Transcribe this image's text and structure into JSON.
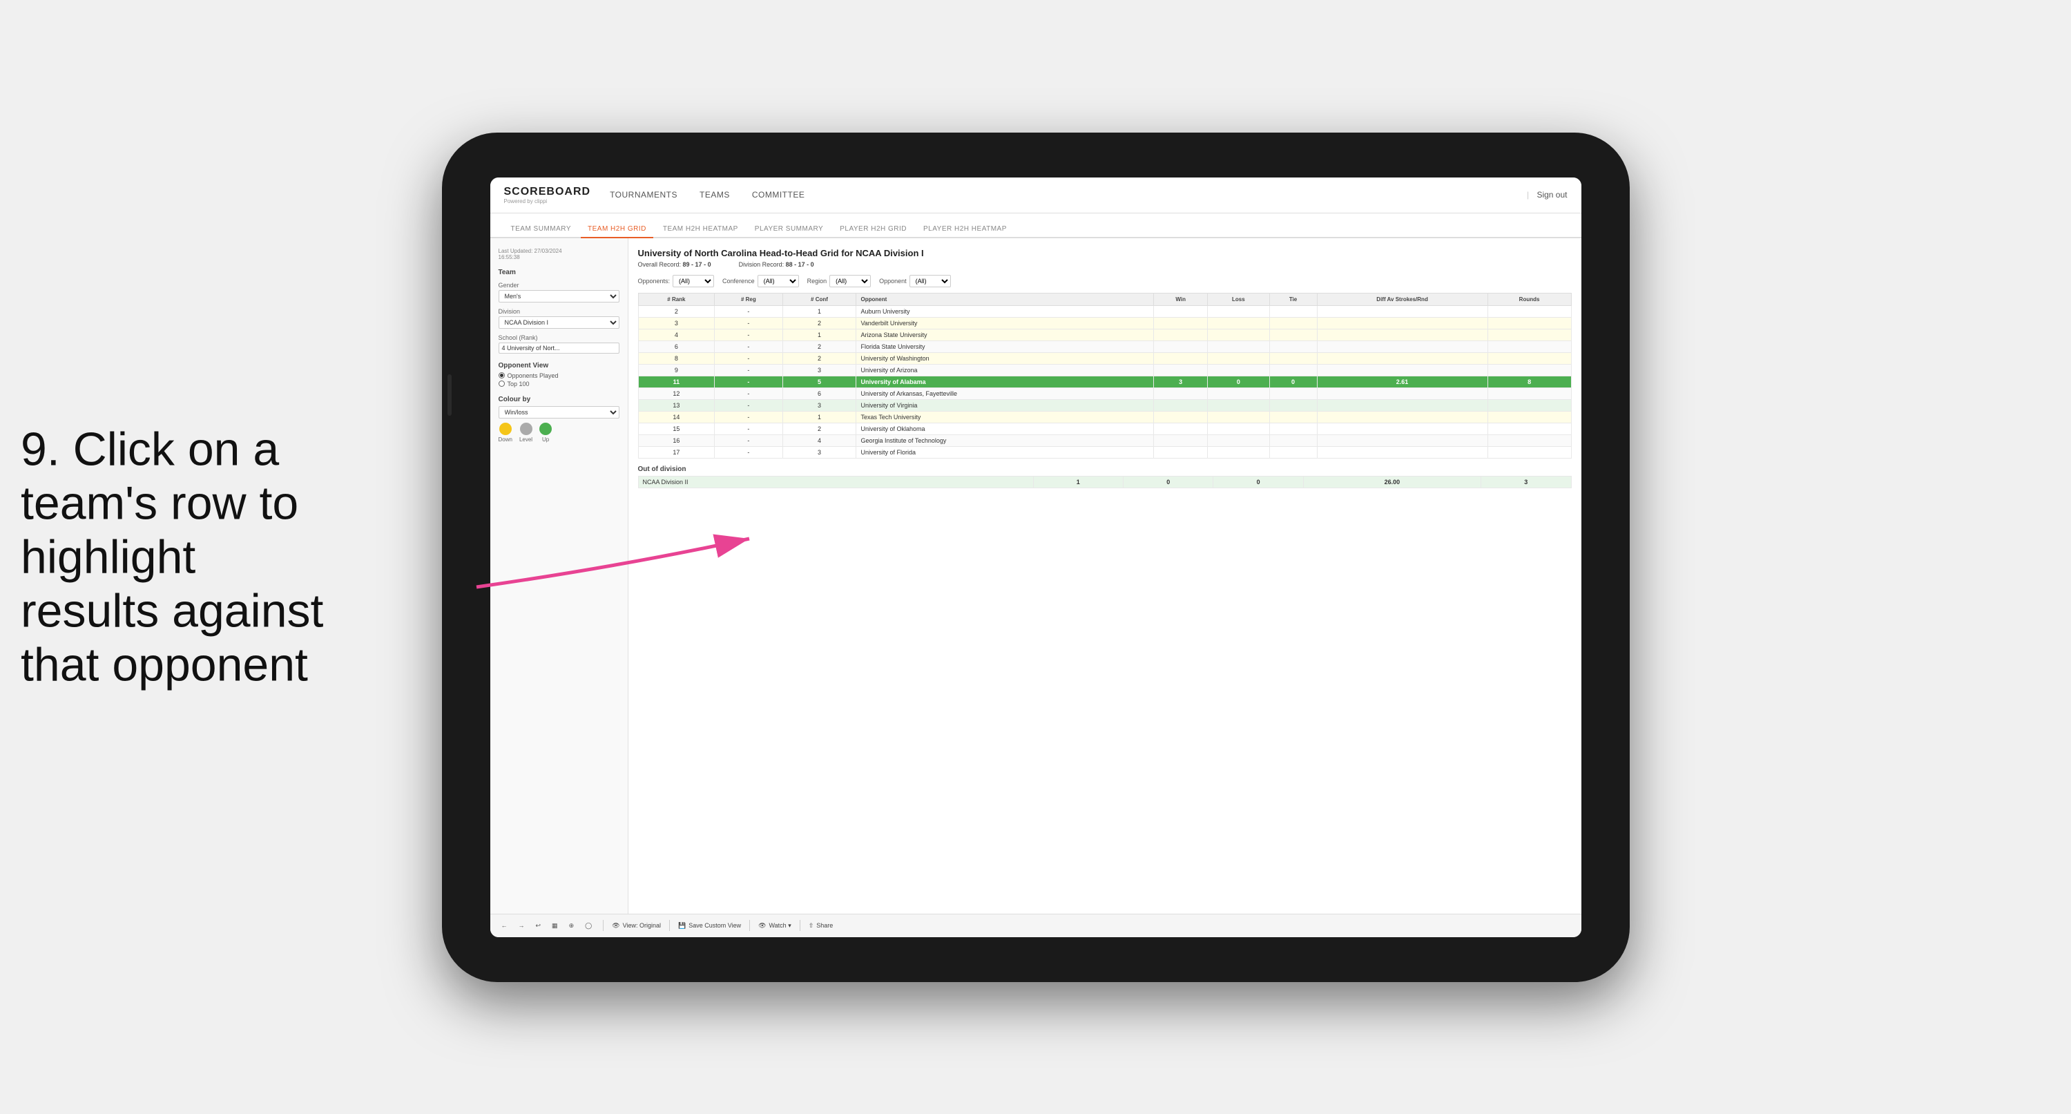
{
  "annotation": {
    "text": "9. Click on a team's row to highlight results against that opponent"
  },
  "nav": {
    "logo": "SCOREBOARD",
    "logo_sub": "Powered by clippi",
    "links": [
      "TOURNAMENTS",
      "TEAMS",
      "COMMITTEE"
    ],
    "sign_out": "Sign out"
  },
  "sub_nav": {
    "items": [
      "TEAM SUMMARY",
      "TEAM H2H GRID",
      "TEAM H2H HEATMAP",
      "PLAYER SUMMARY",
      "PLAYER H2H GRID",
      "PLAYER H2H HEATMAP"
    ],
    "active": "TEAM H2H GRID"
  },
  "sidebar": {
    "last_updated": "Last Updated: 27/03/2024",
    "last_updated_time": "16:55:38",
    "team_label": "Team",
    "gender_label": "Gender",
    "gender_value": "Men's",
    "division_label": "Division",
    "division_value": "NCAA Division I",
    "school_label": "School (Rank)",
    "school_value": "4 University of Nort...",
    "opponent_view_label": "Opponent View",
    "radio_options": [
      "Opponents Played",
      "Top 100"
    ],
    "radio_selected": "Opponents Played",
    "colour_by_label": "Colour by",
    "colour_by_value": "Win/loss",
    "legend": [
      {
        "label": "Down",
        "color": "#f5c518"
      },
      {
        "label": "Level",
        "color": "#aaa"
      },
      {
        "label": "Up",
        "color": "#4caf50"
      }
    ]
  },
  "grid": {
    "title": "University of North Carolina Head-to-Head Grid for NCAA Division I",
    "overall_record_label": "Overall Record:",
    "overall_record": "89 - 17 - 0",
    "division_record_label": "Division Record:",
    "division_record": "88 - 17 - 0",
    "filters": {
      "conference_label": "Conference",
      "conference_value": "(All)",
      "region_label": "Region",
      "region_value": "(All)",
      "opponent_label": "Opponent",
      "opponent_value": "(All)"
    },
    "opponents_label": "Opponents:",
    "table_headers": [
      "# Rank",
      "# Reg",
      "# Conf",
      "Opponent",
      "Win",
      "Loss",
      "Tie",
      "Diff Av Strokes/Rnd",
      "Rounds"
    ],
    "rows": [
      {
        "rank": "2",
        "reg": "-",
        "conf": "1",
        "opponent": "Auburn University",
        "win": "",
        "loss": "",
        "tie": "",
        "diff": "",
        "rounds": "",
        "style": ""
      },
      {
        "rank": "3",
        "reg": "-",
        "conf": "2",
        "opponent": "Vanderbilt University",
        "win": "",
        "loss": "",
        "tie": "",
        "diff": "",
        "rounds": "",
        "style": "light-yellow"
      },
      {
        "rank": "4",
        "reg": "-",
        "conf": "1",
        "opponent": "Arizona State University",
        "win": "",
        "loss": "",
        "tie": "",
        "diff": "",
        "rounds": "",
        "style": "light-yellow"
      },
      {
        "rank": "6",
        "reg": "-",
        "conf": "2",
        "opponent": "Florida State University",
        "win": "",
        "loss": "",
        "tie": "",
        "diff": "",
        "rounds": "",
        "style": ""
      },
      {
        "rank": "8",
        "reg": "-",
        "conf": "2",
        "opponent": "University of Washington",
        "win": "",
        "loss": "",
        "tie": "",
        "diff": "",
        "rounds": "",
        "style": "light-yellow"
      },
      {
        "rank": "9",
        "reg": "-",
        "conf": "3",
        "opponent": "University of Arizona",
        "win": "",
        "loss": "",
        "tie": "",
        "diff": "",
        "rounds": "",
        "style": ""
      },
      {
        "rank": "11",
        "reg": "-",
        "conf": "5",
        "opponent": "University of Alabama",
        "win": "3",
        "loss": "0",
        "tie": "0",
        "diff": "2.61",
        "rounds": "8",
        "style": "highlighted"
      },
      {
        "rank": "12",
        "reg": "-",
        "conf": "6",
        "opponent": "University of Arkansas, Fayetteville",
        "win": "",
        "loss": "",
        "tie": "",
        "diff": "",
        "rounds": "",
        "style": ""
      },
      {
        "rank": "13",
        "reg": "-",
        "conf": "3",
        "opponent": "University of Virginia",
        "win": "",
        "loss": "",
        "tie": "",
        "diff": "",
        "rounds": "",
        "style": "light-green"
      },
      {
        "rank": "14",
        "reg": "-",
        "conf": "1",
        "opponent": "Texas Tech University",
        "win": "",
        "loss": "",
        "tie": "",
        "diff": "",
        "rounds": "",
        "style": "light-yellow"
      },
      {
        "rank": "15",
        "reg": "-",
        "conf": "2",
        "opponent": "University of Oklahoma",
        "win": "",
        "loss": "",
        "tie": "",
        "diff": "",
        "rounds": "",
        "style": ""
      },
      {
        "rank": "16",
        "reg": "-",
        "conf": "4",
        "opponent": "Georgia Institute of Technology",
        "win": "",
        "loss": "",
        "tie": "",
        "diff": "",
        "rounds": "",
        "style": ""
      },
      {
        "rank": "17",
        "reg": "-",
        "conf": "3",
        "opponent": "University of Florida",
        "win": "",
        "loss": "",
        "tie": "",
        "diff": "",
        "rounds": "",
        "style": ""
      }
    ],
    "out_of_division_label": "Out of division",
    "out_of_division_rows": [
      {
        "division": "NCAA Division II",
        "win": "1",
        "loss": "0",
        "tie": "0",
        "diff": "26.00",
        "rounds": "3"
      }
    ]
  },
  "toolbar": {
    "buttons": [
      "←",
      "→",
      "↩",
      "⊞",
      "⊕",
      "○"
    ],
    "view_label": "View: Original",
    "save_label": "Save Custom View",
    "watch_label": "Watch ▾",
    "share_label": "Share"
  }
}
